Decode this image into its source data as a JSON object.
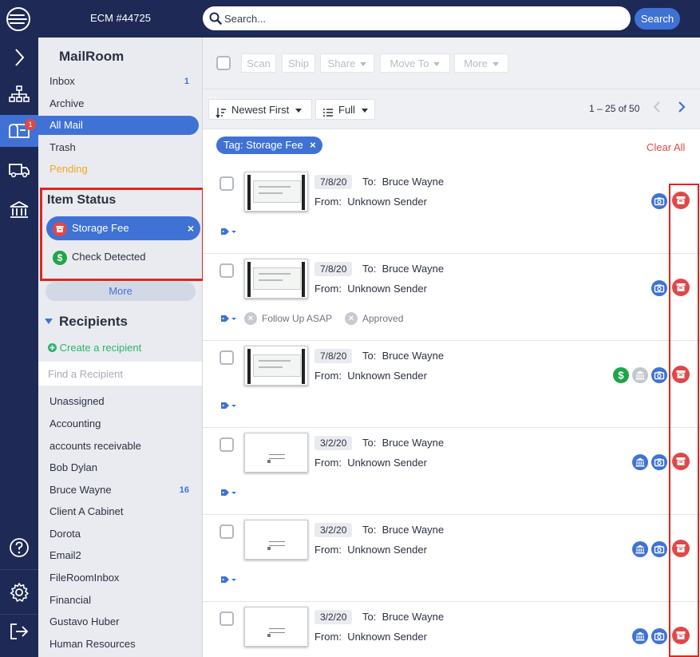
{
  "header": {
    "app_title": "ECM #44725",
    "search_placeholder": "Search...",
    "search_button": "Search"
  },
  "rail": {
    "mail_badge": "1"
  },
  "sidebar": {
    "heading": "MailRoom",
    "items": [
      {
        "label": "Inbox",
        "count": "1"
      },
      {
        "label": "Archive",
        "count": ""
      },
      {
        "label": "All Mail",
        "count": ""
      },
      {
        "label": "Trash",
        "count": ""
      },
      {
        "label": "Pending",
        "count": ""
      }
    ],
    "item_status": {
      "heading": "Item Status",
      "items": [
        {
          "label": "Storage Fee"
        },
        {
          "label": "Check Detected"
        }
      ]
    },
    "more_label": "More",
    "recipients": {
      "heading": "Recipients",
      "create_label": "Create a recipient",
      "find_placeholder": "Find a Recipient",
      "items": [
        {
          "label": "Unassigned",
          "count": ""
        },
        {
          "label": "Accounting",
          "count": ""
        },
        {
          "label": "accounts receivable",
          "count": ""
        },
        {
          "label": "Bob Dylan",
          "count": ""
        },
        {
          "label": "Bruce Wayne",
          "count": "16"
        },
        {
          "label": "Client A Cabinet",
          "count": ""
        },
        {
          "label": "Dorota",
          "count": ""
        },
        {
          "label": "Email2",
          "count": ""
        },
        {
          "label": "FileRoomInbox",
          "count": ""
        },
        {
          "label": "Financial",
          "count": ""
        },
        {
          "label": "Gustavo Huber",
          "count": ""
        },
        {
          "label": "Human Resources",
          "count": ""
        }
      ]
    }
  },
  "toolbar": {
    "scan": "Scan",
    "ship": "Ship",
    "share": "Share",
    "move_to": "Move To",
    "more": "More"
  },
  "sortbar": {
    "sort_label": "Newest First",
    "view_label": "Full",
    "pager": "1 – 25 of 50"
  },
  "filter": {
    "tag_label": "Tag: Storage Fee",
    "clear_all": "Clear All"
  },
  "mail_items": [
    {
      "date": "7/8/20",
      "to_label": "To:",
      "to": "Bruce Wayne",
      "from_label": "From:",
      "from": "Unknown Sender",
      "thumb": "dark",
      "tags": [],
      "icons": [
        "camera",
        "storage"
      ]
    },
    {
      "date": "7/8/20",
      "to_label": "To:",
      "to": "Bruce Wayne",
      "from_label": "From:",
      "from": "Unknown Sender",
      "thumb": "dark",
      "tags": [
        "Follow Up ASAP",
        "Approved"
      ],
      "icons": [
        "camera",
        "storage"
      ]
    },
    {
      "date": "7/8/20",
      "to_label": "To:",
      "to": "Bruce Wayne",
      "from_label": "From:",
      "from": "Unknown Sender",
      "thumb": "dark",
      "tags": [],
      "icons": [
        "check",
        "bank-grey",
        "camera",
        "storage"
      ]
    },
    {
      "date": "3/2/20",
      "to_label": "To:",
      "to": "Bruce Wayne",
      "from_label": "From:",
      "from": "Unknown Sender",
      "thumb": "letter",
      "tags": [],
      "icons": [
        "bank",
        "camera",
        "storage"
      ]
    },
    {
      "date": "3/2/20",
      "to_label": "To:",
      "to": "Bruce Wayne",
      "from_label": "From:",
      "from": "Unknown Sender",
      "thumb": "letter",
      "tags": [],
      "icons": [
        "bank",
        "camera",
        "storage"
      ]
    },
    {
      "date": "3/2/20",
      "to_label": "To:",
      "to": "Bruce Wayne",
      "from_label": "From:",
      "from": "Unknown Sender",
      "thumb": "letter",
      "tags": [],
      "icons": [
        "bank",
        "camera",
        "storage"
      ]
    }
  ],
  "colors": {
    "navy": "#1e2a55",
    "accent": "#3f72d4",
    "danger": "#e04848",
    "success": "#2db36b",
    "pending": "#f5a623",
    "highlight": "#e0261d"
  }
}
